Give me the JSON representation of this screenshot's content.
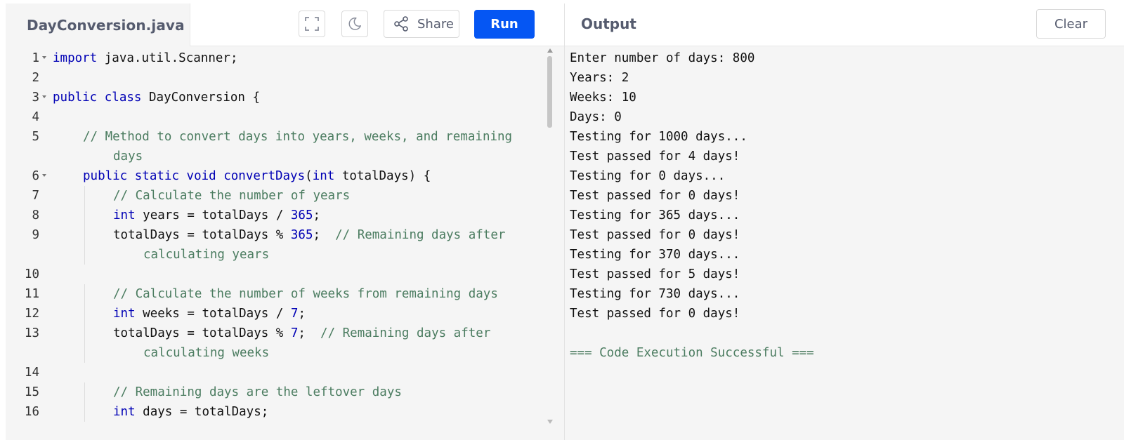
{
  "editor": {
    "file_name": "DayConversion.java",
    "share_label": "Share",
    "run_label": "Run",
    "fullscreen_icon": "fullscreen-icon",
    "theme_icon": "moon-icon",
    "share_icon": "share-icon",
    "lines": [
      {
        "n": "1",
        "fold": true,
        "indent": 0,
        "text": "import java.util.Scanner;"
      },
      {
        "n": "2",
        "fold": false,
        "indent": 0,
        "text": ""
      },
      {
        "n": "3",
        "fold": true,
        "indent": 0,
        "text": "public class DayConversion {"
      },
      {
        "n": "4",
        "fold": false,
        "indent": 0,
        "text": ""
      },
      {
        "n": "5",
        "fold": false,
        "indent": 1,
        "text": "// Method to convert days into years, weeks, and remaining"
      },
      {
        "n": "",
        "fold": false,
        "indent": 1,
        "wrap": true,
        "text": "days"
      },
      {
        "n": "6",
        "fold": true,
        "indent": 1,
        "text": "public static void convertDays(int totalDays) {"
      },
      {
        "n": "7",
        "fold": false,
        "indent": 2,
        "text": "// Calculate the number of years"
      },
      {
        "n": "8",
        "fold": false,
        "indent": 2,
        "text": "int years = totalDays / 365;"
      },
      {
        "n": "9",
        "fold": false,
        "indent": 2,
        "text": "totalDays = totalDays % 365;  // Remaining days after"
      },
      {
        "n": "",
        "fold": false,
        "indent": 2,
        "wrap": true,
        "text": "calculating years"
      },
      {
        "n": "10",
        "fold": false,
        "indent": 0,
        "text": ""
      },
      {
        "n": "11",
        "fold": false,
        "indent": 2,
        "text": "// Calculate the number of weeks from remaining days"
      },
      {
        "n": "12",
        "fold": false,
        "indent": 2,
        "text": "int weeks = totalDays / 7;"
      },
      {
        "n": "13",
        "fold": false,
        "indent": 2,
        "text": "totalDays = totalDays % 7;  // Remaining days after"
      },
      {
        "n": "",
        "fold": false,
        "indent": 2,
        "wrap": true,
        "text": "calculating weeks"
      },
      {
        "n": "14",
        "fold": false,
        "indent": 0,
        "text": ""
      },
      {
        "n": "15",
        "fold": false,
        "indent": 2,
        "text": "// Remaining days are the leftover days"
      },
      {
        "n": "16",
        "fold": false,
        "indent": 2,
        "text": "int days = totalDays;"
      }
    ]
  },
  "output": {
    "title": "Output",
    "clear_label": "Clear",
    "lines": [
      "Enter number of days: 800",
      "Years: 2",
      "Weeks: 10",
      "Days: 0",
      "Testing for 1000 days...",
      "Test passed for 4 days!",
      "Testing for 0 days...",
      "Test passed for 0 days!",
      "Testing for 365 days...",
      "Test passed for 0 days!",
      "Testing for 370 days...",
      "Test passed for 5 days!",
      "Testing for 730 days...",
      "Test passed for 0 days!",
      "",
      "=== Code Execution Successful ==="
    ]
  },
  "colors": {
    "run_button": "#0556f3",
    "keyword": "#0000b5",
    "comment": "#4b7c60",
    "panel_bg": "#f5f5f5"
  }
}
